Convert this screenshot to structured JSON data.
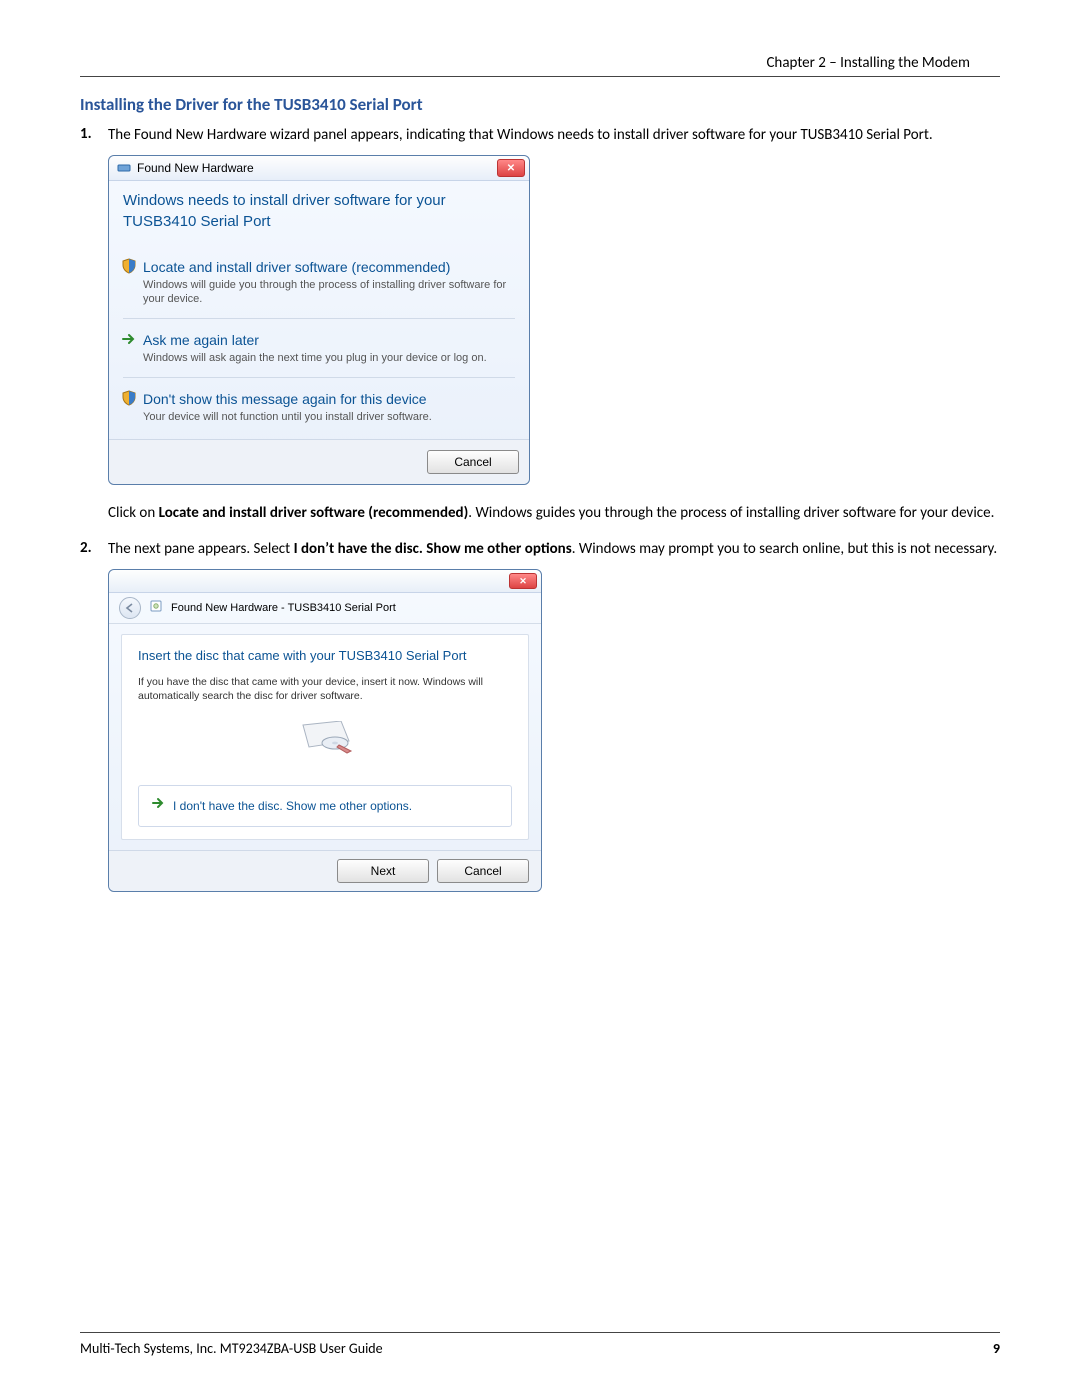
{
  "header": {
    "right": "Chapter 2 – Installing the Modem"
  },
  "section_title": "Installing the Driver for the TUSB3410 Serial Port",
  "steps": [
    {
      "num": "1.",
      "intro": "The Found New Hardware wizard panel appears, indicating that Windows needs to install driver software for your TUSB3410 Serial Port.",
      "after_prefix": "Click on ",
      "after_bold": "Locate and install driver software (recommended)",
      "after_suffix": ". Windows guides you through the process of installing driver software for your device."
    },
    {
      "num": "2.",
      "intro_prefix": "The next pane appears. Select ",
      "intro_bold": "I don’t have the disc. Show me other options",
      "intro_suffix": ". Windows may prompt you to search online, but this is not necessary."
    }
  ],
  "dlg1": {
    "title": "Found New Hardware",
    "headline": "Windows needs to install driver software for your TUSB3410 Serial Port",
    "opts": [
      {
        "label": "Locate and install driver software (recommended)",
        "desc": "Windows will guide you through the process of installing driver software for your device.",
        "icon": "shield"
      },
      {
        "label": "Ask me again later",
        "desc": "Windows will ask again the next time you plug in your device or log on.",
        "icon": "arrow"
      },
      {
        "label": "Don't show this message again for this device",
        "desc": "Your device will not function until you install driver software.",
        "icon": "shield"
      }
    ],
    "cancel": "Cancel"
  },
  "dlg2": {
    "breadcrumb": "Found New Hardware - TUSB3410 Serial Port",
    "heading": "Insert the disc that came with your TUSB3410 Serial Port",
    "sub": "If you have the disc that came with your device, insert it now.  Windows will automatically search the disc for driver software.",
    "option": "I don't have the disc.  Show me other options.",
    "next": "Next",
    "cancel": "Cancel"
  },
  "footer": {
    "left": "Multi-Tech Systems, Inc. MT9234ZBA-USB User Guide",
    "page": "9"
  }
}
